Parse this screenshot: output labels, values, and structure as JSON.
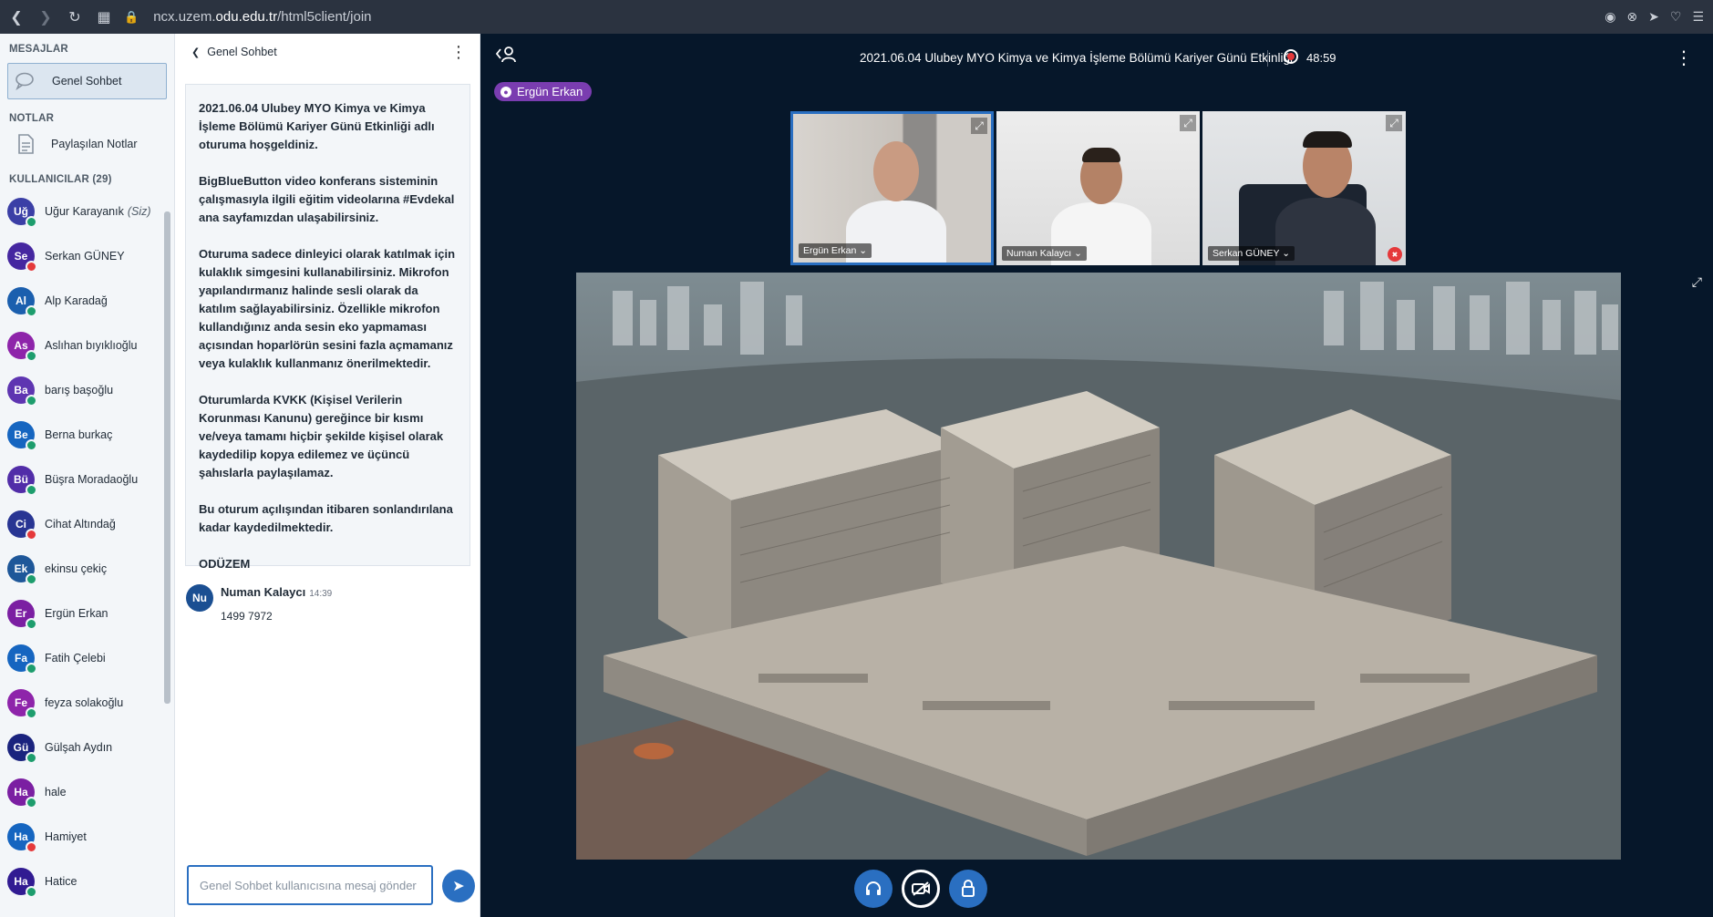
{
  "browser": {
    "url_prefix": "ncx.uzem.",
    "url_domain": "odu.edu.tr",
    "url_path": "/html5client/join"
  },
  "sidebar": {
    "messages_title": "MESAJLAR",
    "public_chat_label": "Genel Sohbet",
    "notes_title": "NOTLAR",
    "shared_notes_label": "Paylaşılan Notlar",
    "users_title": "KULLANICILAR (29)",
    "self_suffix": "(Siz)",
    "users": [
      {
        "initials": "Uğ",
        "name": "Uğur Karayanık",
        "color": "#3B3FA6",
        "status": "ok",
        "self": true
      },
      {
        "initials": "Se",
        "name": "Serkan GÜNEY",
        "color": "#4527A0",
        "status": "mute"
      },
      {
        "initials": "Al",
        "name": "Alp Karadağ",
        "color": "#1B5FAE",
        "status": "ok"
      },
      {
        "initials": "As",
        "name": "Aslıhan bıyıklıoğlu",
        "color": "#8E24AA",
        "status": "ok"
      },
      {
        "initials": "Ba",
        "name": "barış başoğlu",
        "color": "#5E35B1",
        "status": "ok"
      },
      {
        "initials": "Be",
        "name": "Berna burkaç",
        "color": "#1565C0",
        "status": "ok"
      },
      {
        "initials": "Bü",
        "name": "Büşra Moradaoğlu",
        "color": "#512DA8",
        "status": "ok"
      },
      {
        "initials": "Ci",
        "name": "Cihat Altındağ",
        "color": "#283593",
        "status": "mute"
      },
      {
        "initials": "Ek",
        "name": "ekinsu çekiç",
        "color": "#1E5799",
        "status": "ok"
      },
      {
        "initials": "Er",
        "name": "Ergün Erkan",
        "color": "#7B1FA2",
        "status": "ok"
      },
      {
        "initials": "Fa",
        "name": "Fatih Çelebi",
        "color": "#1565C0",
        "status": "ok"
      },
      {
        "initials": "Fe",
        "name": "feyza solakoğlu",
        "color": "#8E24AA",
        "status": "ok"
      },
      {
        "initials": "Gü",
        "name": "Gülşah Aydın",
        "color": "#1A237E",
        "status": "ok"
      },
      {
        "initials": "Ha",
        "name": "hale",
        "color": "#7B1FA2",
        "status": "ok"
      },
      {
        "initials": "Ha",
        "name": "Hamiyet",
        "color": "#1565C0",
        "status": "mute"
      },
      {
        "initials": "Ha",
        "name": "Hatice",
        "color": "#311B92",
        "status": "ok"
      }
    ]
  },
  "chat": {
    "back_label": "Genel Sohbet",
    "welcome": [
      "2021.06.04 Ulubey MYO Kimya ve Kimya İşleme Bölümü Kariyer Günü Etkinliği adlı oturuma hoşgeldiniz.",
      "BigBlueButton video konferans sisteminin çalışmasıyla ilgili eğitim videolarına #Evdekal ana sayfamızdan ulaşabilirsiniz.",
      "Oturuma sadece dinleyici olarak katılmak için kulaklık simgesini kullanabilirsiniz. Mikrofon yapılandırmanız halinde sesli olarak da katılım sağlayabilirsiniz. Özellikle mikrofon kullandığınız anda sesin eko yapmaması açısından hoparlörün sesini fazla açmamanız veya kulaklık kullanmanız önerilmektedir.",
      "Oturumlarda KVKK (Kişisel Verilerin Korunması Kanunu) gereğince bir kısmı ve/veya tamamı hiçbir şekilde kişisel olarak kaydedilip kopya edilemez ve üçüncü şahıslarla paylaşılamaz.",
      "Bu oturum açılışından itibaren sonlandırılana kadar kaydedilmektedir.",
      "ODÜZEM"
    ],
    "message": {
      "initials": "Nu",
      "sender": "Numan Kalaycı",
      "time": "14:39",
      "text": "1499 7972"
    },
    "input_placeholder": "Genel Sohbet kullanıcısına mesaj gönder"
  },
  "meeting": {
    "title": "2021.06.04 Ulubey MYO Kimya ve Kimya İşleme Bölümü Kariyer Günü Etkinliği",
    "recording_time": "48:59",
    "talking": "Ergün Erkan",
    "videos": [
      {
        "name": "Ergün Erkan ⌄",
        "active": true,
        "muted": false
      },
      {
        "name": "Numan Kalaycı ⌄",
        "active": false,
        "muted": false
      },
      {
        "name": "Serkan GÜNEY ⌄",
        "active": false,
        "muted": true
      }
    ]
  },
  "icons": {
    "back": "chevron-left-icon",
    "more": "more-vertical-icon",
    "audio": "headphones-icon",
    "video": "camera-off-icon",
    "lock": "lock-icon",
    "send": "send-icon"
  }
}
